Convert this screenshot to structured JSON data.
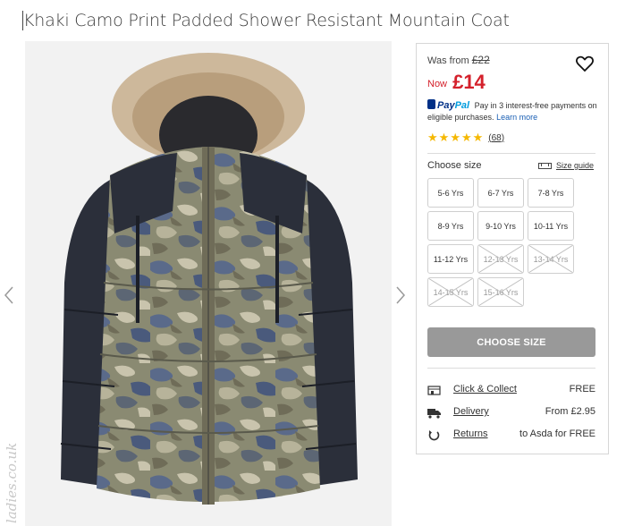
{
  "product": {
    "title": "Khaki Camo Print Padded Shower Resistant Mountain Coat"
  },
  "gallery": {
    "image_alt": "Khaki camo print padded coat with faux fur hood",
    "watermark": "ladies.co.uk"
  },
  "price": {
    "was_label": "Was from",
    "was_value": "£22",
    "now_label": "Now",
    "now_value": "£14"
  },
  "paypal": {
    "brand_a": "Pay",
    "brand_b": "Pal",
    "message": "Pay in 3 interest-free payments on eligible purchases.",
    "link": "Learn more"
  },
  "rating": {
    "stars": 5,
    "count": "(68)"
  },
  "size": {
    "label": "Choose size",
    "guide": "Size guide",
    "options": [
      {
        "label": "5-6 Yrs",
        "available": true
      },
      {
        "label": "6-7 Yrs",
        "available": true
      },
      {
        "label": "7-8 Yrs",
        "available": true
      },
      {
        "label": "8-9 Yrs",
        "available": true
      },
      {
        "label": "9-10 Yrs",
        "available": true
      },
      {
        "label": "10-11 Yrs",
        "available": true
      },
      {
        "label": "11-12 Yrs",
        "available": true
      },
      {
        "label": "12-13 Yrs",
        "available": false
      },
      {
        "label": "13-14 Yrs",
        "available": false
      },
      {
        "label": "14-15 Yrs",
        "available": false
      },
      {
        "label": "15-16 Yrs",
        "available": false
      }
    ]
  },
  "cta": {
    "label": "CHOOSE SIZE"
  },
  "delivery": [
    {
      "name": "Click & Collect",
      "value": "FREE",
      "icon": "store-icon"
    },
    {
      "name": "Delivery",
      "value": "From £2.95",
      "icon": "truck-icon"
    },
    {
      "name": "Returns",
      "value": "to Asda for FREE",
      "icon": "returns-icon"
    }
  ],
  "colors": {
    "price_red": "#d4202b",
    "cta_grey": "#999999",
    "star": "#f5b800"
  }
}
